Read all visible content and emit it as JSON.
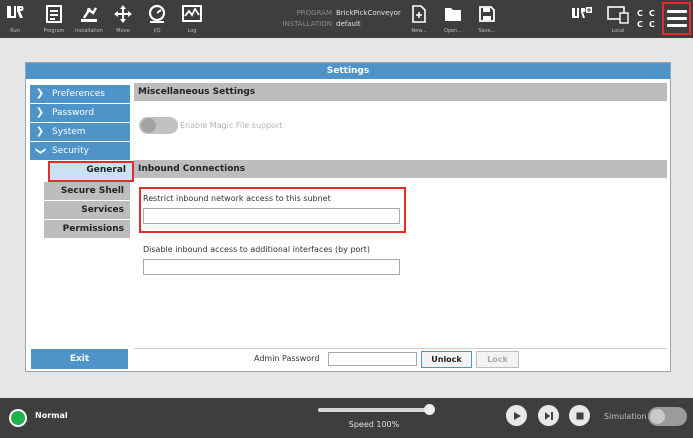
{
  "toolbar": {
    "buttons": [
      {
        "label": "Run",
        "icon": "ur-logo-icon"
      },
      {
        "label": "Program",
        "icon": "program-icon"
      },
      {
        "label": "Installation",
        "icon": "installation-icon"
      },
      {
        "label": "Move",
        "icon": "move-icon"
      },
      {
        "label": "I/O",
        "icon": "io-icon"
      },
      {
        "label": "Log",
        "icon": "log-icon"
      }
    ],
    "program_key": "PROGRAM",
    "program_value": "BrickPickConveyor",
    "installation_key": "INSTALLATION",
    "installation_value": "default",
    "file_buttons": [
      {
        "label": "New...",
        "icon": "new-file-icon"
      },
      {
        "label": "Open...",
        "icon": "open-folder-icon"
      },
      {
        "label": "Save...",
        "icon": "save-icon"
      }
    ],
    "ur_plus_icon": "ur-plus-icon",
    "local_label": "Local",
    "ccc": [
      "C",
      "C",
      "C",
      "C"
    ],
    "menu_icon": "hamburger-menu-icon"
  },
  "settings": {
    "title": "Settings",
    "nav": [
      {
        "label": "Preferences",
        "expanded": false
      },
      {
        "label": "Password",
        "expanded": false
      },
      {
        "label": "System",
        "expanded": false
      },
      {
        "label": "Security",
        "expanded": true
      }
    ],
    "security_subitems": [
      "General",
      "Secure Shell",
      "Services",
      "Permissions"
    ],
    "active_subitem": "General",
    "exit_label": "Exit",
    "misc_header": "Miscellaneous Settings",
    "magic_file_label": "Enable Magic File support",
    "magic_file_enabled": false,
    "inbound_header": "Inbound Connections",
    "subnet_label": "Restrict inbound network access to this subnet",
    "subnet_value": "",
    "ports_label": "Disable inbound access to additional interfaces (by port)",
    "ports_value": "",
    "admin_password_label": "Admin Password",
    "admin_password_value": "",
    "unlock_label": "Unlock",
    "lock_label": "Lock"
  },
  "footer": {
    "status": "Normal",
    "status_color": "#21b14a",
    "speed_label": "Speed 100%",
    "speed_fraction": 1.0,
    "simulation_label": "Simulation",
    "simulation_on": false
  },
  "colors": {
    "accent": "#4e94c8",
    "highlight": "#e52b2b",
    "bar": "#3e3e3e"
  }
}
